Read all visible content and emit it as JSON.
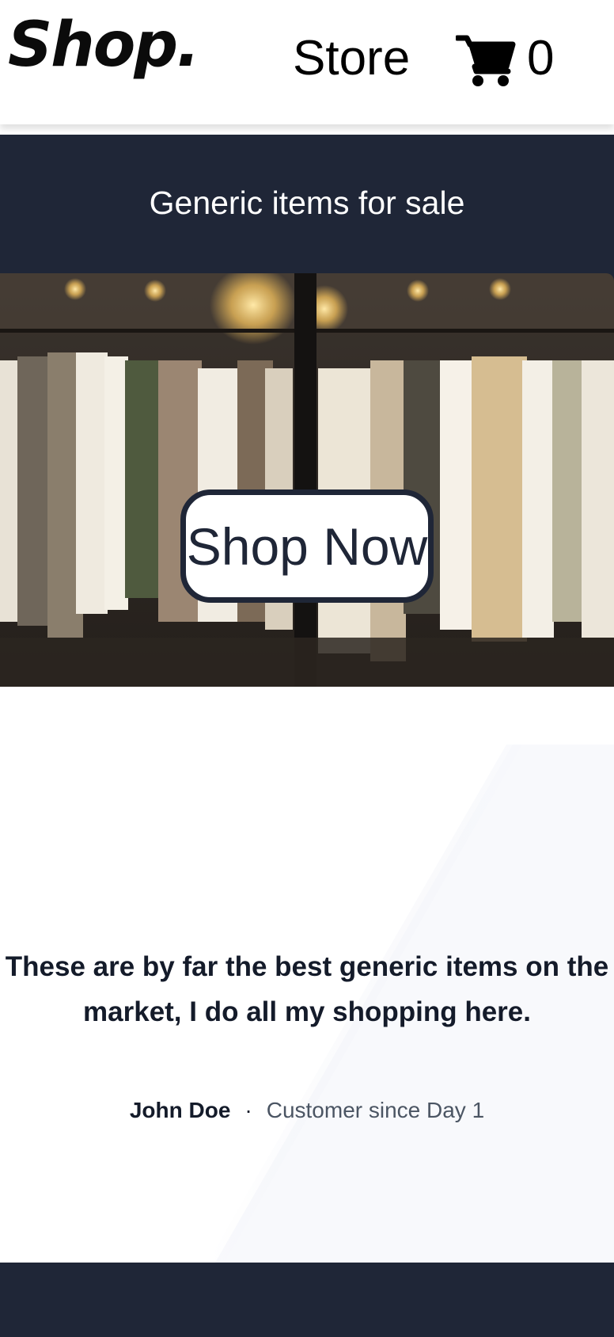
{
  "header": {
    "logo": "Shop.",
    "nav_store": "Store",
    "cart_icon": "shopping-cart-icon",
    "cart_count": "0"
  },
  "hero": {
    "title": "Generic items for sale",
    "image": "clothing-rack-photo",
    "cta_label": "Shop Now"
  },
  "testimonial": {
    "quote": "These are by far the best generic items on the market, I do all my shopping here.",
    "author": "John Doe",
    "separator": "·",
    "role": "Customer since Day 1"
  },
  "colors": {
    "navy": "#1f2637",
    "text_dark": "#141b2a",
    "text_muted": "#4b5563",
    "white": "#ffffff"
  }
}
